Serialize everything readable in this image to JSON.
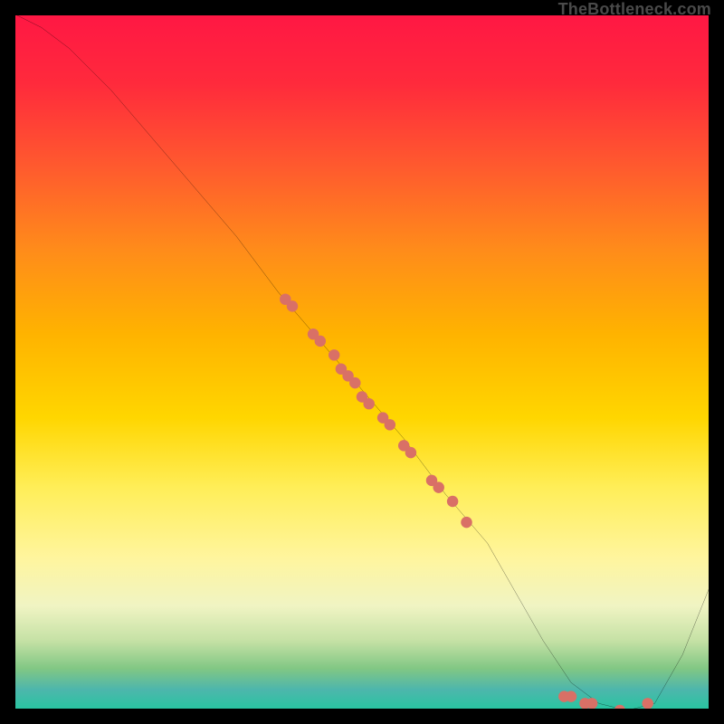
{
  "watermark": "TheBottleneck.com",
  "chart_data": {
    "type": "line",
    "title": "",
    "xlabel": "",
    "ylabel": "",
    "xlim": [
      0,
      100
    ],
    "ylim": [
      0,
      100
    ],
    "grid": false,
    "series": [
      {
        "name": "curve",
        "x": [
          0,
          4,
          8,
          14,
          20,
          26,
          32,
          38,
          44,
          50,
          56,
          62,
          68,
          72,
          76,
          80,
          84,
          88,
          92,
          96,
          100
        ],
        "y": [
          100,
          98,
          95,
          89,
          82,
          75,
          68,
          60,
          53,
          46,
          39,
          31,
          24,
          17,
          10,
          4,
          1,
          0,
          1,
          8,
          18
        ],
        "stroke": "#000000",
        "stroke_width": 2
      }
    ],
    "marker_points": {
      "name": "dots",
      "color": "#d97066",
      "radius": 6.2,
      "points": [
        {
          "x": 39,
          "y": 59
        },
        {
          "x": 40,
          "y": 58
        },
        {
          "x": 43,
          "y": 54
        },
        {
          "x": 44,
          "y": 53
        },
        {
          "x": 46,
          "y": 51
        },
        {
          "x": 47,
          "y": 49
        },
        {
          "x": 48,
          "y": 48
        },
        {
          "x": 49,
          "y": 47
        },
        {
          "x": 50,
          "y": 45
        },
        {
          "x": 51,
          "y": 44
        },
        {
          "x": 53,
          "y": 42
        },
        {
          "x": 54,
          "y": 41
        },
        {
          "x": 56,
          "y": 38
        },
        {
          "x": 57,
          "y": 37
        },
        {
          "x": 60,
          "y": 33
        },
        {
          "x": 61,
          "y": 32
        },
        {
          "x": 63,
          "y": 30
        },
        {
          "x": 65,
          "y": 27
        },
        {
          "x": 79,
          "y": 2
        },
        {
          "x": 80,
          "y": 2
        },
        {
          "x": 82,
          "y": 1
        },
        {
          "x": 83,
          "y": 1
        },
        {
          "x": 87,
          "y": 0
        },
        {
          "x": 91,
          "y": 1
        }
      ]
    }
  }
}
